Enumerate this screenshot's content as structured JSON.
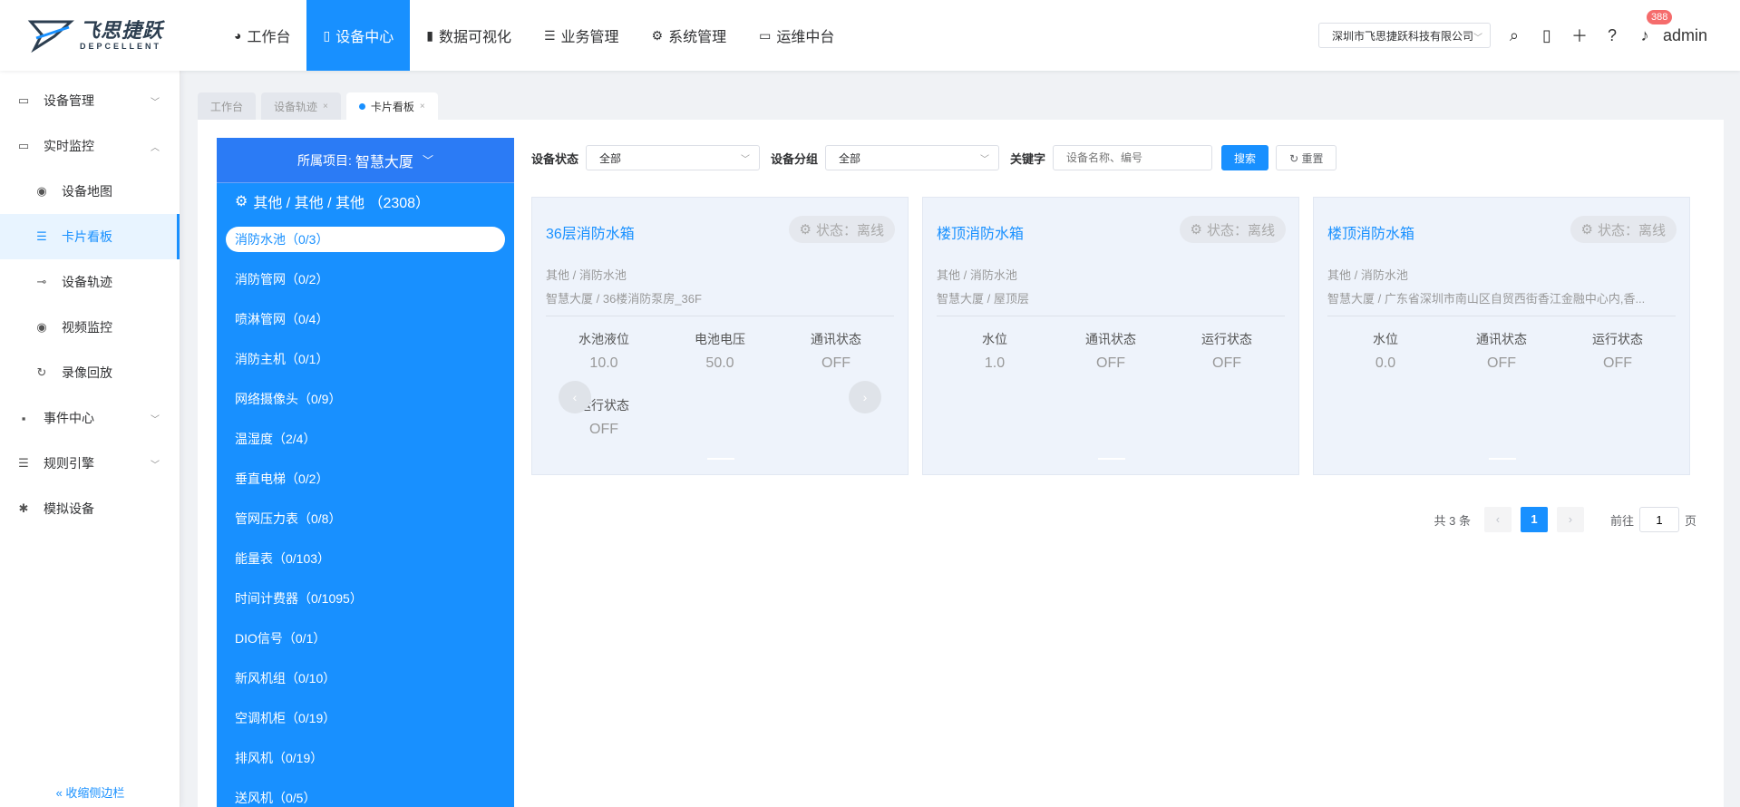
{
  "header": {
    "logo_cn": "飞思捷跃",
    "logo_en": "DEPCELLENT",
    "nav": [
      {
        "label": "工作台",
        "icon": "dashboard-icon"
      },
      {
        "label": "设备中心",
        "icon": "mobile-icon",
        "active": true
      },
      {
        "label": "数据可视化",
        "icon": "bar-chart-icon"
      },
      {
        "label": "业务管理",
        "icon": "list-icon"
      },
      {
        "label": "系统管理",
        "icon": "gear-icon"
      },
      {
        "label": "运维中台",
        "icon": "monitor-icon"
      }
    ],
    "company": "深圳市飞思捷跃科技有限公司",
    "notify_count": "388",
    "user": "admin"
  },
  "sidebar": {
    "items": [
      {
        "label": "设备管理"
      },
      {
        "label": "实时监控"
      },
      {
        "label": "设备地图"
      },
      {
        "label": "卡片看板"
      },
      {
        "label": "设备轨迹"
      },
      {
        "label": "视频监控"
      },
      {
        "label": "录像回放"
      },
      {
        "label": "事件中心"
      },
      {
        "label": "规则引擎"
      },
      {
        "label": "模拟设备"
      }
    ],
    "collapse_label": "收缩侧边栏"
  },
  "tabs": [
    {
      "label": "工作台"
    },
    {
      "label": "设备轨迹"
    },
    {
      "label": "卡片看板",
      "active": true
    }
  ],
  "tree": {
    "project_label": "所属项目:",
    "project_value": "智慧大厦",
    "root": "其他 / 其他 / 其他 （2308）",
    "nodes": [
      "消防水池（0/3）",
      "消防管网（0/2）",
      "喷淋管网（0/4）",
      "消防主机（0/1）",
      "网络摄像头（0/9）",
      "温湿度（2/4）",
      "垂直电梯（0/2）",
      "管网压力表（0/8）",
      "能量表（0/103）",
      "时间计费器（0/1095）",
      "DIO信号（0/1）",
      "新风机组（0/10）",
      "空调机柜（0/19）",
      "排风机（0/19）",
      "送风机（0/5）"
    ]
  },
  "filters": {
    "status_label": "设备状态",
    "status_value": "全部",
    "group_label": "设备分组",
    "group_value": "全部",
    "keyword_label": "关键字",
    "keyword_placeholder": "设备名称、编号",
    "search": "搜索",
    "reset": "重置"
  },
  "cards": [
    {
      "title": "36层消防水箱",
      "status": "状态：离线",
      "path": "其他 / 消防水池",
      "location": "智慧大厦 / 36楼消防泵房_36F",
      "metrics": [
        {
          "label": "水池液位",
          "value": "10.0"
        },
        {
          "label": "电池电压",
          "value": "50.0"
        },
        {
          "label": "通讯状态",
          "value": "OFF"
        },
        {
          "label": "运行状态",
          "value": "OFF"
        }
      ]
    },
    {
      "title": "楼顶消防水箱",
      "status": "状态：离线",
      "path": "其他 / 消防水池",
      "location": "智慧大厦 / 屋顶层",
      "metrics": [
        {
          "label": "水位",
          "value": "1.0"
        },
        {
          "label": "通讯状态",
          "value": "OFF"
        },
        {
          "label": "运行状态",
          "value": "OFF"
        }
      ]
    },
    {
      "title": "楼顶消防水箱",
      "status": "状态：离线",
      "path": "其他 / 消防水池",
      "location": "智慧大厦 / 广东省深圳市南山区自贸西街香江金融中心内,香...",
      "metrics": [
        {
          "label": "水位",
          "value": "0.0"
        },
        {
          "label": "通讯状态",
          "value": "OFF"
        },
        {
          "label": "运行状态",
          "value": "OFF"
        }
      ]
    }
  ],
  "pager": {
    "total": "共 3 条",
    "current": "1",
    "goto_label": "前往",
    "goto_value": "1",
    "page_suffix": "页"
  }
}
